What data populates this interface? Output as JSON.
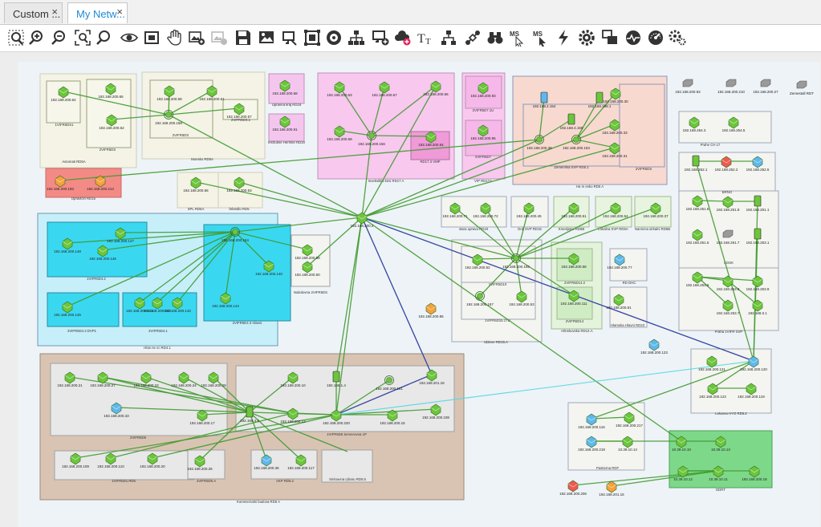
{
  "tabs": [
    {
      "label": "Custom ...",
      "active": false
    },
    {
      "label": "My Netw...",
      "active": true
    }
  ],
  "close_glyph": "×",
  "toolbar": [
    {
      "icon": "zoom-area-icon"
    },
    {
      "icon": "zoom-in-icon"
    },
    {
      "icon": "zoom-out-icon"
    },
    {
      "icon": "zoom-fit-icon"
    },
    {
      "icon": "zoom-search-icon"
    },
    {
      "icon": "eye-icon"
    },
    {
      "icon": "fullscreen-icon"
    },
    {
      "icon": "hand-pan-icon"
    },
    {
      "icon": "add-image-icon"
    },
    {
      "icon": "image-disabled-icon"
    },
    {
      "icon": "save-icon"
    },
    {
      "icon": "picture-icon"
    },
    {
      "icon": "monitor-icon"
    },
    {
      "icon": "frame-icon"
    },
    {
      "icon": "disk-icon"
    },
    {
      "icon": "tree-layout-icon"
    },
    {
      "icon": "add-device-icon"
    },
    {
      "icon": "cloud-add-icon"
    },
    {
      "icon": "text-icon",
      "text": "TT"
    },
    {
      "icon": "tree-add-icon"
    },
    {
      "icon": "connect-icon"
    },
    {
      "icon": "binoculars-icon"
    },
    {
      "icon": "ms-cursor-icon",
      "text": "MS"
    },
    {
      "icon": "ms-cursor-2-icon",
      "text": "MS"
    },
    {
      "icon": "bolt-icon"
    },
    {
      "icon": "gear-icon"
    },
    {
      "icon": "layers-icon"
    },
    {
      "icon": "monitor-pulse-icon"
    },
    {
      "icon": "dashboard-icon"
    },
    {
      "icon": "settings-icon"
    }
  ],
  "colors": {
    "node_green": "#6cc63b",
    "node_orange": "#f4a23a",
    "node_red": "#ee5a4f",
    "node_blue": "#5fb8ec",
    "node_gray": "#9a9a9a",
    "link_green": "#3f9a2f",
    "link_blue": "#3a3ac8",
    "link_cyan": "#57d7e3"
  },
  "groups": [
    {
      "label": "Avtomati RD5A",
      "fill": "#f4f3e6",
      "stroke": "#cfcfb8"
    },
    {
      "label": "1VIFR5DS1",
      "fill": "#f6f6ea",
      "stroke": "#9aa07a"
    },
    {
      "label": "2VIFR5DS",
      "fill": "#f6f6ea",
      "stroke": "#9aa07a"
    },
    {
      "label": "Monsko RD5A",
      "fill": "#f4f3e6",
      "stroke": "#cfcfb8"
    },
    {
      "label": "2VIFR5DS",
      "fill": "#f4f3e6",
      "stroke": "#9aa07a"
    },
    {
      "label": "2VIFR5DS.1",
      "fill": "#f6f6ea",
      "stroke": "#9aa07a"
    },
    {
      "label": "Upravna kraj RD18",
      "fill": "#f4c6ee",
      "stroke": "#c090b8"
    },
    {
      "label": "Instrukne Hermite RD20",
      "fill": "#f4c6ee",
      "stroke": "#c090b8"
    },
    {
      "label": "Inveksiklni krisi RD17 A",
      "fill": "#f8c8ee",
      "stroke": "#c090b8"
    },
    {
      "label": "RD17.3 VMP",
      "fill": "#f09ad8",
      "stroke": "#b070a0"
    },
    {
      "label": "VIP RD17A",
      "fill": "#f8c8ee",
      "stroke": "#c090b8"
    },
    {
      "label": "2VIFR5D7.1U",
      "fill": "#f5b8e8",
      "stroke": "#c090b8"
    },
    {
      "label": "2VIFR5D7",
      "fill": "#f5b8e8",
      "stroke": "#c090b8"
    },
    {
      "label": "Ha m esko RD5 A",
      "fill": "#f7d9d0",
      "stroke": "#8c97b8"
    },
    {
      "label": "Zemenlina SVP RD5.1",
      "fill": "#f7d9d0",
      "stroke": "#8c97b8"
    },
    {
      "label": "2VIFR5DS",
      "fill": "#f7d9d0",
      "stroke": "#8c97b8"
    },
    {
      "label": "Dpravlcin RD15",
      "fill": "#f48a86",
      "stroke": "#c86a66"
    },
    {
      "label": "SPL RD5A",
      "fill": "#f4f3e6",
      "stroke": "#cfcfb8"
    },
    {
      "label": "brlandlo RD5",
      "fill": "#f4f3e6",
      "stroke": "#cfcfb8"
    },
    {
      "label": "Hlas ne zc RD4.1",
      "fill": "#c6effa",
      "stroke": "#6a9ab0"
    },
    {
      "label": "1VIFR5D4.2",
      "fill": "#3ad8f0",
      "stroke": "#2a8aa0"
    },
    {
      "label": "2VIFR5D4.3 Hlavni",
      "fill": "#3ad8f0",
      "stroke": "#2a8aa0"
    },
    {
      "label": "2VIFR5D4.3 DVP1",
      "fill": "#3ad8f0",
      "stroke": "#2a8aa0"
    },
    {
      "label": "2VIFR5D4.1",
      "fill": "#3ad8f0",
      "stroke": "#2a8aa0"
    },
    {
      "label": "Nalsdovna 2VIFR5DS",
      "fill": "#f4f4f0",
      "stroke": "#a0a0a0"
    },
    {
      "label": "stara uprava RD19",
      "fill": "#f4f4f0",
      "stroke": "#a0a8b8"
    },
    {
      "label": "Dok SVP RD15",
      "fill": "#f4f4f0",
      "stroke": "#a0a8b8"
    },
    {
      "label": "Kmetijstvo RD5B",
      "fill": "#e8f4e0",
      "stroke": "#a0b890"
    },
    {
      "label": "Lokalna SVP RD5A",
      "fill": "#e8f4e0",
      "stroke": "#a0b890"
    },
    {
      "label": "Namizna sirkalni RD5B",
      "fill": "#e8f4e0",
      "stroke": "#a0b890"
    },
    {
      "label": "Ublene RD15.A",
      "fill": "#f4f4f0",
      "stroke": "#a0a8b8"
    },
    {
      "label": "1VIFR5D10",
      "fill": "#f4f4f0",
      "stroke": "#a0a8b8"
    },
    {
      "label": "1VIFR5D15.1TU",
      "fill": "#f4f4f0",
      "stroke": "#a0a8b8"
    },
    {
      "label": "Hlinskovska RD14.A",
      "fill": "#e3f3dc",
      "stroke": "#a0b890"
    },
    {
      "label": "2VIFR5D14.2",
      "fill": "#cfecc4",
      "stroke": "#a0b890"
    },
    {
      "label": "2VIFR5D14",
      "fill": "#cfecc4",
      "stroke": "#a0b890"
    },
    {
      "label": "RD DHC",
      "fill": "#f4f4f0",
      "stroke": "#a0a8b8"
    },
    {
      "label": "Hlamska Hlavni RD23",
      "fill": "#f4f4f0",
      "stroke": "#a0a8b8"
    },
    {
      "label": "Prahe CH LT",
      "fill": "#f4f4f0",
      "stroke": "#a0a8b8"
    },
    {
      "label": "BRNO",
      "fill": "#f4f4f0",
      "stroke": "#a0a8b8"
    },
    {
      "label": "CDSK",
      "fill": "#f4f4f0",
      "stroke": "#a0a8b8"
    },
    {
      "label": "Praha 1VIFR SVP",
      "fill": "#f4f4f0",
      "stroke": "#a0a8b8"
    },
    {
      "label": "Kommerzalni budova RD5 A",
      "fill": "#d9c4b4",
      "stroke": "#9a8a7a"
    },
    {
      "label": "2VIFR5D5",
      "fill": "#e8e8e8",
      "stroke": "#a0a0a0"
    },
    {
      "label": "1VIFR5D5 Serverovna 1P",
      "fill": "#e8e8e8",
      "stroke": "#a0a0a0"
    },
    {
      "label": "1VIFR5D1.RD5",
      "fill": "#e8e8e8",
      "stroke": "#a0a0a0"
    },
    {
      "label": "2VIFR5D5.A",
      "fill": "#e8e8e8",
      "stroke": "#a0a0a0"
    },
    {
      "label": "AKP RD5.2",
      "fill": "#e8e8e8",
      "stroke": "#a0a0a0"
    },
    {
      "label": "Smlouvna rybaru RD5.5",
      "fill": "#e8e8e8",
      "stroke": "#a0a0a0"
    },
    {
      "label": "Lekarna HYO RD5.2",
      "fill": "#f4f4f0",
      "stroke": "#a0a8b8"
    },
    {
      "label": "Pastierna RDF",
      "fill": "#f4f4f0",
      "stroke": "#a0a8b8"
    },
    {
      "label": "DDRT",
      "fill": "#7ed889",
      "stroke": "#4aa058"
    }
  ],
  "nodes": [
    {
      "ip": "192.168.200.64",
      "kind": "switch",
      "color": "green"
    },
    {
      "ip": "192.168.200.65",
      "kind": "switch",
      "color": "green"
    },
    {
      "ip": "192.168.200.62",
      "kind": "switch",
      "color": "green"
    },
    {
      "ip": "192.168.200.59",
      "kind": "switch",
      "color": "green"
    },
    {
      "ip": "192.168.200.61",
      "kind": "switch",
      "color": "green"
    },
    {
      "ip": "192.168.200.158",
      "kind": "wireless",
      "color": "green"
    },
    {
      "ip": "192.168.200.57",
      "kind": "switch",
      "color": "green"
    },
    {
      "ip": "192.168.200.68",
      "kind": "switch",
      "color": "green"
    },
    {
      "ip": "192.168.200.91",
      "kind": "switch",
      "color": "green"
    },
    {
      "ip": "192.168.200.63",
      "kind": "switch",
      "color": "green"
    },
    {
      "ip": "192.168.200.67",
      "kind": "switch",
      "color": "green"
    },
    {
      "ip": "192.168.200.66",
      "kind": "switch",
      "color": "green"
    },
    {
      "ip": "192.168.200.69",
      "kind": "switch",
      "color": "green"
    },
    {
      "ip": "192.168.200.156",
      "kind": "wireless",
      "color": "green"
    },
    {
      "ip": "192.168.200.94",
      "kind": "switch",
      "color": "green"
    },
    {
      "ip": "192.168.200.93",
      "kind": "switch",
      "color": "green"
    },
    {
      "ip": "192.168.200.95",
      "kind": "switch",
      "color": "green"
    },
    {
      "ip": "192.168.4.154",
      "kind": "server",
      "color": "blue"
    },
    {
      "ip": "192.168.4.155",
      "kind": "server",
      "color": "green"
    },
    {
      "ip": "192.168.198.1",
      "kind": "server",
      "color": "green"
    },
    {
      "ip": "192.168.200.30",
      "kind": "switch",
      "color": "green"
    },
    {
      "ip": "192.168.200.39",
      "kind": "wireless",
      "color": "green"
    },
    {
      "ip": "192.168.200.153",
      "kind": "wireless",
      "color": "green"
    },
    {
      "ip": "192.168.200.33",
      "kind": "switch",
      "color": "green"
    },
    {
      "ip": "192.168.200.31",
      "kind": "switch",
      "color": "green"
    },
    {
      "ip": "192.168.200.193",
      "kind": "switch",
      "color": "orange"
    },
    {
      "ip": "192.168.200.214",
      "kind": "switch",
      "color": "orange"
    },
    {
      "ip": "192.168.200.56",
      "kind": "switch",
      "color": "green"
    },
    {
      "ip": "192.168.200.53",
      "kind": "switch",
      "color": "green"
    },
    {
      "ip": "192.168.200.2",
      "kind": "switch",
      "color": "green"
    },
    {
      "ip": "192.168.200.147",
      "kind": "switch",
      "color": "green"
    },
    {
      "ip": "192.168.200.148",
      "kind": "switch",
      "color": "green"
    },
    {
      "ip": "192.168.200.146",
      "kind": "switch",
      "color": "green"
    },
    {
      "ip": "192.168.200.154",
      "kind": "wireless",
      "color": "green"
    },
    {
      "ip": "192.168.200.140",
      "kind": "switch",
      "color": "green"
    },
    {
      "ip": "192.168.200.144",
      "kind": "switch",
      "color": "green"
    },
    {
      "ip": "192.168.200.143",
      "kind": "switch",
      "color": "green"
    },
    {
      "ip": "192.168.200.145",
      "kind": "switch",
      "color": "green"
    },
    {
      "ip": "192.168.200.141",
      "kind": "switch",
      "color": "green"
    },
    {
      "ip": "192.168.200.142",
      "kind": "switch",
      "color": "green"
    },
    {
      "ip": "192.168.200.59",
      "kind": "switch",
      "color": "green"
    },
    {
      "ip": "192.168.200.50",
      "kind": "switch",
      "color": "green"
    },
    {
      "ip": "192.168.200.71",
      "kind": "switch",
      "color": "green"
    },
    {
      "ip": "192.168.200.72",
      "kind": "switch",
      "color": "green"
    },
    {
      "ip": "192.168.200.45",
      "kind": "switch",
      "color": "green"
    },
    {
      "ip": "192.168.200.51",
      "kind": "switch",
      "color": "green"
    },
    {
      "ip": "192.168.200.54",
      "kind": "switch",
      "color": "green"
    },
    {
      "ip": "192.168.200.37",
      "kind": "switch",
      "color": "green"
    },
    {
      "ip": "192.168.200.52",
      "kind": "switch",
      "color": "green"
    },
    {
      "ip": "192.168.200.155",
      "kind": "wireless",
      "color": "green"
    },
    {
      "ip": "192.168.200.157",
      "kind": "wireless",
      "color": "green"
    },
    {
      "ip": "192.168.200.53",
      "kind": "switch",
      "color": "green"
    },
    {
      "ip": "192.168.200.58",
      "kind": "switch",
      "color": "green"
    },
    {
      "ip": "192.168.200.111",
      "kind": "switch",
      "color": "green"
    },
    {
      "ip": "192.168.200.77",
      "kind": "switch",
      "color": "blue"
    },
    {
      "ip": "192.168.200.81",
      "kind": "switch",
      "color": "green"
    },
    {
      "ip": "192.168.200.86",
      "kind": "switch",
      "color": "orange"
    },
    {
      "ip": "192.168.200.93",
      "kind": "printer",
      "color": "gray"
    },
    {
      "ip": "192.168.200.210",
      "kind": "printer",
      "color": "gray"
    },
    {
      "ip": "192.168.200.27",
      "kind": "printer",
      "color": "gray"
    },
    {
      "ip": "Zemestall RDT",
      "kind": "printer",
      "color": "gray"
    },
    {
      "ip": "192.168.254.3",
      "kind": "switch",
      "color": "green"
    },
    {
      "ip": "192.168.254.5",
      "kind": "switch",
      "color": "green"
    },
    {
      "ip": "192.168.252.1",
      "kind": "server",
      "color": "green"
    },
    {
      "ip": "192.168.252.2",
      "kind": "switch",
      "color": "red"
    },
    {
      "ip": "192.168.252.5",
      "kind": "switch",
      "color": "blue"
    },
    {
      "ip": "192.168.251.6",
      "kind": "switch",
      "color": "green"
    },
    {
      "ip": "192.168.251.8",
      "kind": "switch",
      "color": "green"
    },
    {
      "ip": "192.168.251.1",
      "kind": "server",
      "color": "green"
    },
    {
      "ip": "192.168.251.5",
      "kind": "switch",
      "color": "green"
    },
    {
      "ip": "192.168.251.7",
      "kind": "printer",
      "color": "gray"
    },
    {
      "ip": "192.168.253.1",
      "kind": "server",
      "color": "green"
    },
    {
      "ip": "192.168.253.6",
      "kind": "switch",
      "color": "green"
    },
    {
      "ip": "192.168.253.8",
      "kind": "switch",
      "color": "green"
    },
    {
      "ip": "192.168.253.9",
      "kind": "switch",
      "color": "green"
    },
    {
      "ip": "192.168.253.7",
      "kind": "switch",
      "color": "green"
    },
    {
      "ip": "192.168.0.1",
      "kind": "switch",
      "color": "green"
    },
    {
      "ip": "192.168.200.123",
      "kind": "switch",
      "color": "blue"
    },
    {
      "ip": "192.168.200.121",
      "kind": "switch",
      "color": "green"
    },
    {
      "ip": "192.168.200.120",
      "kind": "switch",
      "color": "blue"
    },
    {
      "ip": "192.168.200.122",
      "kind": "switch",
      "color": "green"
    },
    {
      "ip": "192.168.200.119",
      "kind": "switch",
      "color": "green"
    },
    {
      "ip": "192.168.200.116",
      "kind": "switch",
      "color": "blue"
    },
    {
      "ip": "192.168.200.217",
      "kind": "switch",
      "color": "green"
    },
    {
      "ip": "192.168.200.218",
      "kind": "switch",
      "color": "blue"
    },
    {
      "ip": "10.39.10.14",
      "kind": "switch",
      "color": "green"
    },
    {
      "ip": "10.39.10.10",
      "kind": "switch",
      "color": "green"
    },
    {
      "ip": "10.39.10.13",
      "kind": "switch",
      "color": "green"
    },
    {
      "ip": "10.39.10.12",
      "kind": "switch",
      "color": "green"
    },
    {
      "ip": "10.39.10.11",
      "kind": "switch",
      "color": "green"
    },
    {
      "ip": "192.168.200.18",
      "kind": "switch",
      "color": "green"
    },
    {
      "ip": "192.168.200.206",
      "kind": "switch",
      "color": "red"
    },
    {
      "ip": "192.168.201.15",
      "kind": "switch",
      "color": "orange"
    },
    {
      "ip": "192.168.200.21",
      "kind": "switch",
      "color": "green"
    },
    {
      "ip": "192.168.200.27",
      "kind": "switch",
      "color": "green"
    },
    {
      "ip": "192.168.200.23",
      "kind": "switch",
      "color": "green"
    },
    {
      "ip": "192.168.200.24",
      "kind": "switch",
      "color": "green"
    },
    {
      "ip": "192.168.200.29",
      "kind": "switch",
      "color": "green"
    },
    {
      "ip": "192.168.200.33",
      "kind": "switch",
      "color": "blue"
    },
    {
      "ip": "192.168.200.17",
      "kind": "switch",
      "color": "green"
    },
    {
      "ip": "192.168.4.9",
      "kind": "server",
      "color": "green"
    },
    {
      "ip": "192.168.200.10",
      "kind": "switch",
      "color": "green"
    },
    {
      "ip": "192.168.1.4",
      "kind": "server",
      "color": "green"
    },
    {
      "ip": "192.168.200.151",
      "kind": "wireless",
      "color": "green"
    },
    {
      "ip": "192.168.201.18",
      "kind": "switch",
      "color": "green"
    },
    {
      "ip": "192.168.200.12",
      "kind": "switch",
      "color": "green"
    },
    {
      "ip": "192.168.200.220",
      "kind": "switch",
      "color": "green"
    },
    {
      "ip": "192.168.200.15",
      "kind": "switch",
      "color": "green"
    },
    {
      "ip": "192.168.200.108",
      "kind": "switch",
      "color": "green"
    },
    {
      "ip": "192.168.200.109",
      "kind": "switch",
      "color": "green"
    },
    {
      "ip": "192.168.200.110",
      "kind": "switch",
      "color": "green"
    },
    {
      "ip": "192.168.200.20",
      "kind": "switch",
      "color": "green"
    },
    {
      "ip": "192.168.200.26",
      "kind": "switch",
      "color": "green"
    },
    {
      "ip": "192.168.200.36",
      "kind": "switch",
      "color": "blue"
    },
    {
      "ip": "192.168.200.117",
      "kind": "switch",
      "color": "green"
    }
  ]
}
